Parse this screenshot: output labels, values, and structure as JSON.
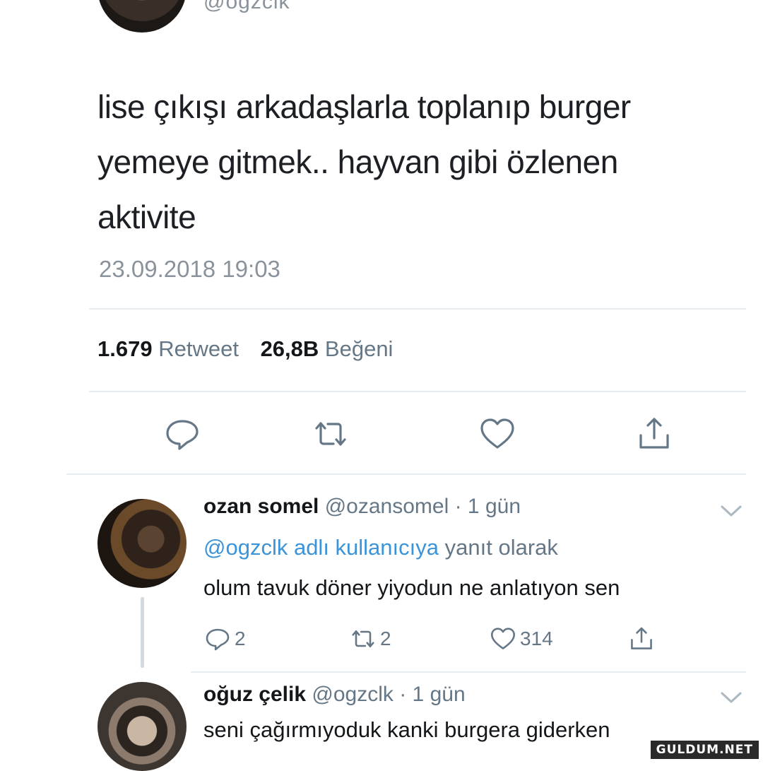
{
  "tweet": {
    "handle": "@ogzclk",
    "text_lines": [
      "lise çıkışı arkadaşlarla toplanıp burger",
      "yemeye gitmek.. hayvan gibi özlenen",
      "aktivite"
    ],
    "date": "23.09.2018 19:03",
    "retweet_count": "1.679",
    "retweet_label": "Retweet",
    "like_count": "26,8B",
    "like_label": "Beğeni",
    "actions": [
      "reply-icon",
      "retweet-icon",
      "heart-icon",
      "share-icon"
    ]
  },
  "replies": [
    {
      "name": "ozan somel",
      "handle": "@ozansomel",
      "time": "· 1 gün",
      "reply_to_link": "@ogzclk adlı kullanıcıya",
      "reply_to_suffix": "yanıt olarak",
      "text": "olum tavuk döner yiyodun ne anlatıyon sen",
      "reply_count": "2",
      "retweet_count": "2",
      "like_count": "314"
    },
    {
      "name": "oğuz çelik",
      "handle": "@ogzclk",
      "time": "· 1 gün",
      "text": "seni çağırmıyoduk kanki burgera giderken"
    }
  ],
  "watermark": "GULDUM.NET",
  "colors": {
    "link": "#3b94d9",
    "muted": "#657786",
    "divider": "#e6ecf0"
  }
}
